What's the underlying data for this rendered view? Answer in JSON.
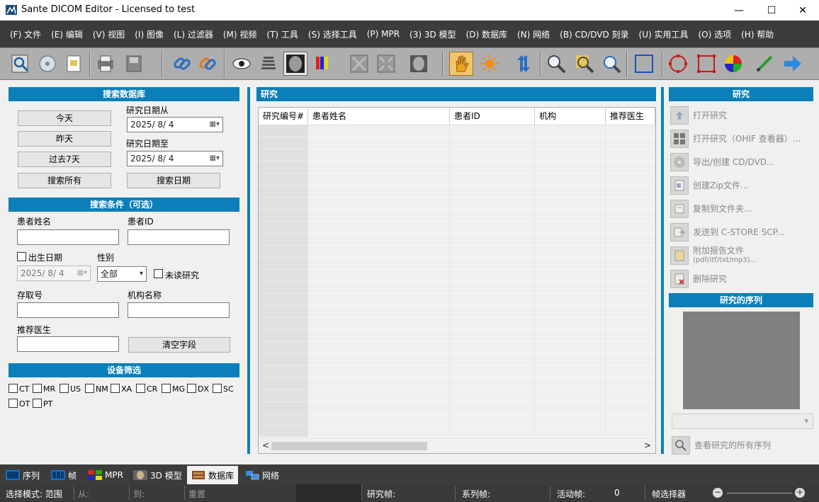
{
  "window": {
    "title": "Sante DICOM Editor - Licensed to test",
    "minimize": "—",
    "maximize": "☐",
    "close": "✕"
  },
  "menu": [
    "(F) 文件",
    "(E) 编辑",
    "(V) 视图",
    "(I) 图像",
    "(L) 过滤器",
    "(M) 视频",
    "(T) 工具",
    "(S) 选择工具",
    "(P) MPR",
    "(3) 3D 模型",
    "(D) 数据库",
    "(N) 网络",
    "(B) CD/DVD 刻录",
    "(U) 实用工具",
    "(O) 选项",
    "(H) 帮助"
  ],
  "left": {
    "search_db_header": "搜索数据库",
    "today": "今天",
    "yesterday": "昨天",
    "last7": "过去7天",
    "search_all": "搜索所有",
    "search_date": "搜索日期",
    "date_from_label": "研究日期从",
    "date_from": "2025/ 8/ 4",
    "date_to_label": "研究日期至",
    "date_to": "2025/ 8/ 4",
    "criteria_header": "搜索条件（可选）",
    "patient_name": "患者姓名",
    "patient_id": "患者ID",
    "birth_date": "出生日期",
    "birth_value": "2025/ 8/ 4",
    "gender": "性别",
    "gender_value": "全部",
    "unread": "未读研究",
    "accession": "存取号",
    "institution": "机构名称",
    "referring": "推荐医生",
    "clear": "清空字段",
    "modality_header": "设备筛选",
    "modalities": [
      "CT",
      "MR",
      "US",
      "NM",
      "XA",
      "CR",
      "MG",
      "DX",
      "SC",
      "OT",
      "PT"
    ]
  },
  "center": {
    "header": "研究",
    "columns": [
      "研究编号#",
      "患者姓名",
      "患者ID",
      "机构",
      "推荐医生"
    ],
    "scroll_left": "<",
    "scroll_right": ">"
  },
  "right": {
    "header": "研究",
    "actions": [
      "打开研究",
      "打开研究（OHIF 查看器）...",
      "导出/创建 CD/DVD...",
      "创建Zip文件...",
      "复制到文件夹...",
      "发送到 C-STORE SCP...",
      "附加报告文件",
      "(pdf/itf/txt/mp3)...",
      "删除研究"
    ],
    "series_header": "研究的序列",
    "view_all": "查看研究的所有序列"
  },
  "tabs": [
    "序列",
    "帧",
    "MPR",
    "3D 模型",
    "数据库",
    "网络"
  ],
  "status": {
    "mode": "选择模式: 范围",
    "from": "从:",
    "to": "到:",
    "reset": "重置",
    "study_frames": "研究帧:",
    "series_frames": "系列帧:",
    "active_frames": "活动帧:",
    "active_value": "0",
    "frame_selector": "帧选择器"
  },
  "colors": {
    "accent": "#0a7fba",
    "menubar": "#3c3c3c"
  }
}
